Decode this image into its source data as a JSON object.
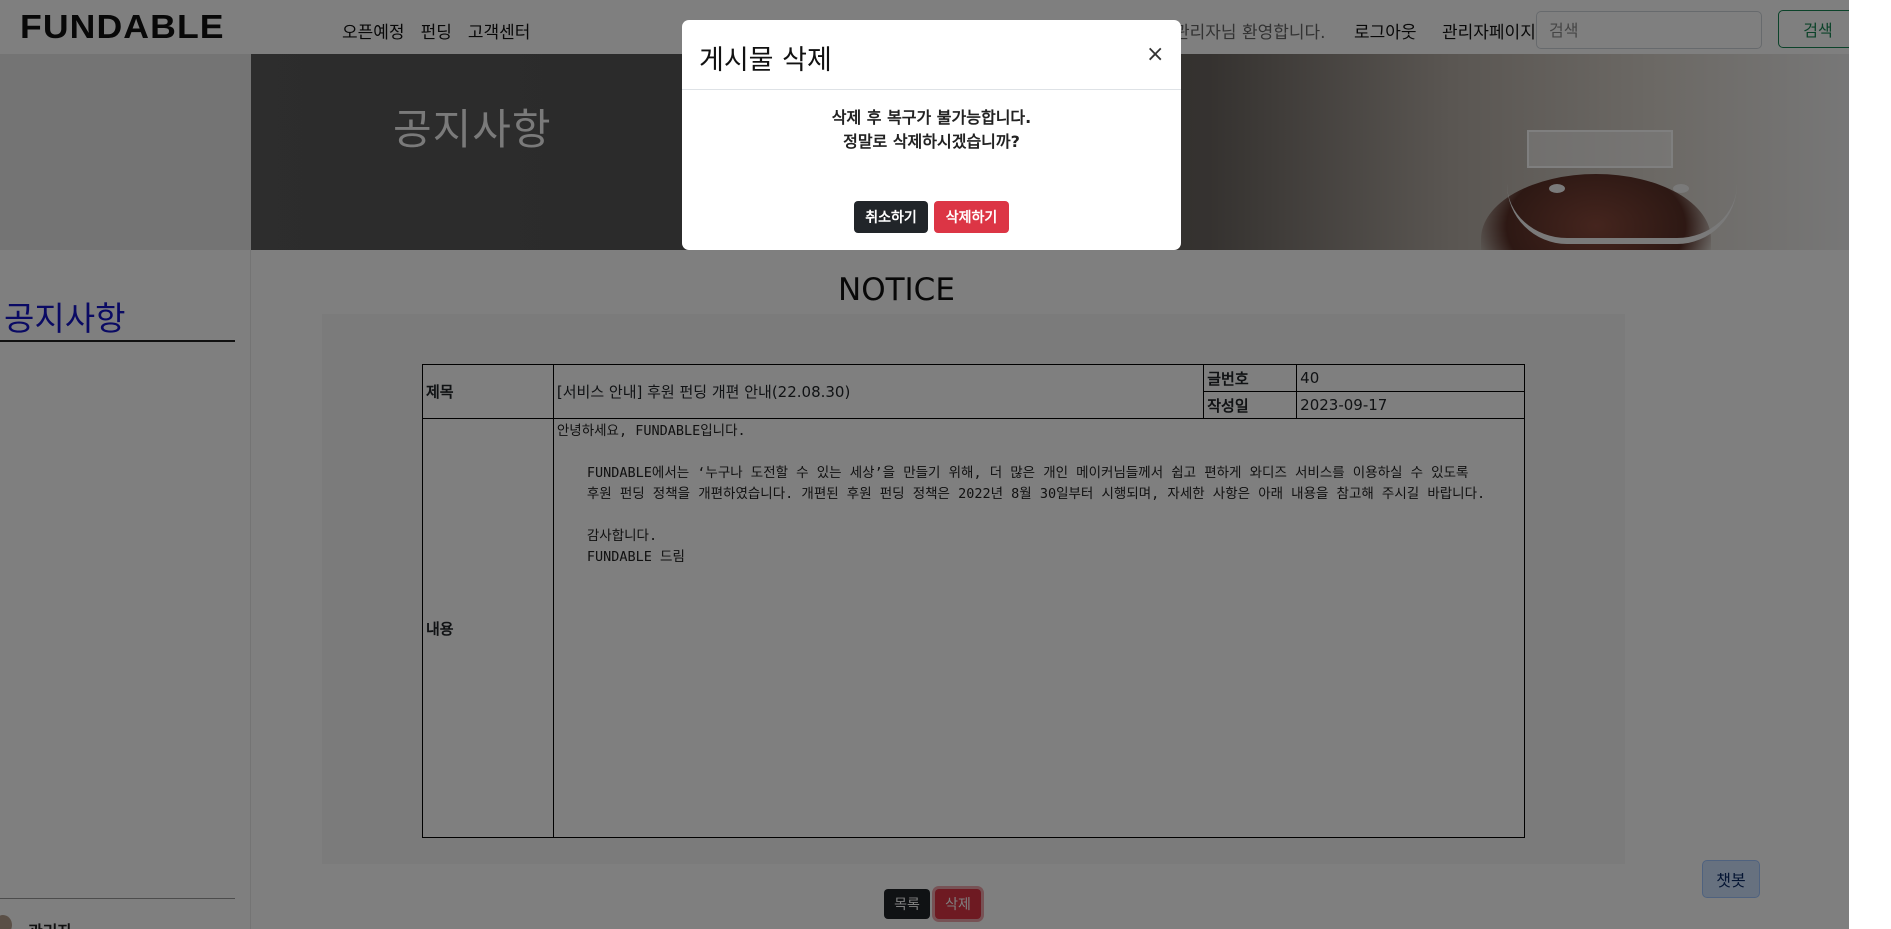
{
  "header": {
    "logo": "FUNDABLE",
    "nav": [
      "오픈예정",
      "펀딩",
      "고객센터"
    ],
    "welcome": "관리자님 환영합니다.",
    "logout": "로그아웃",
    "admin_page": "관리자페이지",
    "search_placeholder": "검색",
    "search_button": "검색"
  },
  "banner": {
    "title": "공지사항"
  },
  "sidebar": {
    "title": "공지사항",
    "user": "관리자"
  },
  "main": {
    "title": "NOTICE",
    "labels": {
      "subject": "제목",
      "number": "글번호",
      "date": "작성일",
      "content": "내용"
    },
    "subject": "[서비스 안내] 후원 펀딩 개편 안내(22.08.30)",
    "number": "40",
    "date": "2023-09-17",
    "content": {
      "line1": "안녕하세요, FUNDABLE입니다.",
      "line2": "FUNDABLE에서는 ‘누구나 도전할 수 있는 세상’을 만들기 위해, 더 많은 개인 메이커님들께서 쉽고 편하게 와디즈 서비스를 이용하실 수 있도록",
      "line3": "후원 펀딩 정책을 개편하였습니다. 개편된 후원 펀딩 정책은 2022년 8월 30일부터 시행되며, 자세한 사항은 아래 내용을 참고해 주시길 바랍니다.",
      "line4": "감사합니다.",
      "line5": "FUNDABLE 드림"
    },
    "list_button": "목록",
    "delete_button": "삭제",
    "chatbot_button": "챗봇"
  },
  "modal": {
    "title": "게시물 삭제",
    "close": "×",
    "line1": "삭제 후 복구가 불가능합니다.",
    "line2": "정말로 삭제하시겠습니까?",
    "cancel": "취소하기",
    "confirm": "삭제하기"
  }
}
